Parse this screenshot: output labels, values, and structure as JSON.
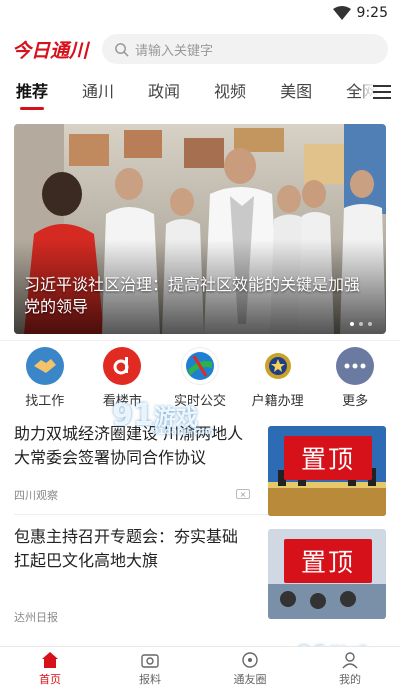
{
  "status": {
    "time": "9:25"
  },
  "header": {
    "logo_text": "今日通川",
    "search_placeholder": "请输入关键字"
  },
  "tabs": [
    {
      "label": "推荐",
      "active": true
    },
    {
      "label": "通川"
    },
    {
      "label": "政闻"
    },
    {
      "label": "视频"
    },
    {
      "label": "美图"
    },
    {
      "label": "全网"
    }
  ],
  "banner": {
    "caption": "习近平谈社区治理：提高社区效能的关键是加强党的领导"
  },
  "services": [
    {
      "label": "找工作",
      "icon": "handshake-icon",
      "color": "#3a86c8"
    },
    {
      "label": "看楼市",
      "icon": "dafangwang-icon",
      "color": "#e02a22"
    },
    {
      "label": "实时公交",
      "icon": "bus-icon",
      "color": "#1f7fd1"
    },
    {
      "label": "户籍办理",
      "icon": "police-badge-icon",
      "color": "#c9a227"
    },
    {
      "label": "更多",
      "icon": "more-icon",
      "color": "#6b7aa0"
    }
  ],
  "news": [
    {
      "title": "助力双城经济圈建设 川渝两地人大常委会签署协同合作协议",
      "source": "四川观察",
      "badge": "置顶"
    },
    {
      "title": "包惠主持召开专题会：夯实基础 扛起巴文化高地大旗",
      "source": "达州日报",
      "badge": "置顶"
    }
  ],
  "bottom_nav": [
    {
      "label": "首页",
      "icon": "home-icon",
      "active": true
    },
    {
      "label": "报料",
      "icon": "camera-icon"
    },
    {
      "label": "通友圈",
      "icon": "chat-icon"
    },
    {
      "label": "我的",
      "icon": "user-icon"
    }
  ],
  "watermark": {
    "top": "91",
    "mid": "游戏",
    "bottom": "91danji.com"
  },
  "colors": {
    "accent": "#d7111a"
  }
}
